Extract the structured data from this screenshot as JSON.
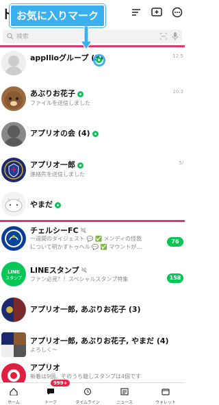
{
  "header": {
    "title": "トーク"
  },
  "annotation": {
    "label": "お気に入りマーク"
  },
  "search": {
    "placeholder": "検索"
  },
  "colors": {
    "accent": "#06c755",
    "annotation": "#3bb0ee",
    "divider": "#e6336a",
    "badge": "#ee2244"
  },
  "favorites": [
    {
      "name": "appllioグループ (3)",
      "time": "12:5",
      "subtitle": "",
      "favorite": true
    },
    {
      "name": "あぶりお花子",
      "time": "10:3",
      "subtitle": "ファイルを送信しました",
      "favorite": true
    },
    {
      "name": "アプリオの会 (4)",
      "time": "",
      "subtitle": "",
      "favorite": true
    },
    {
      "name": "アプリオ一郎",
      "time": "5/",
      "subtitle": "連絡先を送信しました",
      "favorite": true
    },
    {
      "name": "やまだ",
      "time": "",
      "subtitle": "",
      "favorite": true
    }
  ],
  "chats": [
    {
      "name": "チェルシーFC",
      "line1": "一週間のダイジェスト 💬 ✅ メンディの怪我",
      "line2": "について明かすトゥヘル 💬 ✅ マウントが…",
      "unread": "76"
    },
    {
      "name": "LINEスタンプ",
      "line1": "ファン必見？！スペシャルスタンプ特集",
      "line2": "",
      "unread": "158"
    },
    {
      "name": "アプリオ一郎, あぶりお花子 (3)",
      "line1": "",
      "line2": ""
    },
    {
      "name": "アプリオ一郎, あぶりお花子, やまだ (4)",
      "line1": "よろしく〜",
      "line2": ""
    },
    {
      "name": "アプリオ",
      "line1": "新着は9個。そのうち聴しスタンプは4個です",
      "line2": ""
    }
  ],
  "tabs": [
    {
      "label": "ホーム",
      "icon": "home-icon"
    },
    {
      "label": "トーク",
      "icon": "talk-icon",
      "badge": "999+"
    },
    {
      "label": "タイムライン",
      "icon": "clock-icon"
    },
    {
      "label": "ニュース",
      "icon": "news-icon"
    },
    {
      "label": "ウォレット",
      "icon": "wallet-icon"
    }
  ]
}
